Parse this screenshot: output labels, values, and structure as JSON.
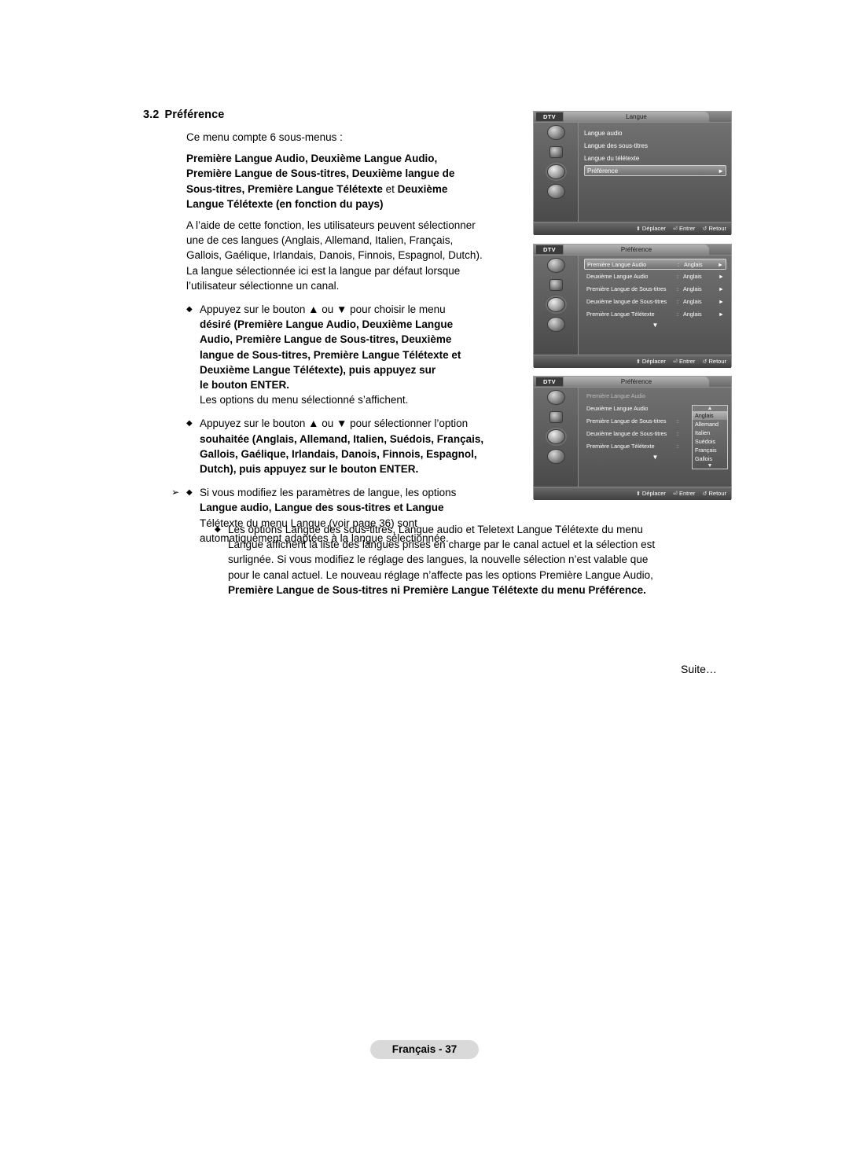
{
  "section": {
    "number": "3.2",
    "title": "Préférence",
    "intro": "Ce menu compte 6 sous-menus :",
    "submenus_line1_bold": "Première Langue Audio",
    "submenus_line1_rest": ", Deuxième Langue Audio,",
    "submenus_line2": "Première Langue de Sous-titres, Deuxième langue de",
    "submenus_line3_a": "Sous-titres, Première Langue Télétexte",
    "submenus_line3_b": " et ",
    "submenus_line3_c": "Deuxième",
    "submenus_line4": "Langue Télétexte (en fonction du pays)",
    "desc_line1": "A l’aide de cette fonction, les utilisateurs peuvent sélectionner",
    "desc_line2": "une de ces langues (Anglais, Allemand, Italien, Français,",
    "desc_line3": "Gallois, Gaélique, Irlandais, Danois, Finnois, Espagnol, Dutch).",
    "desc_line4": "La langue sélectionnée ici est la langue par défaut lorsque",
    "desc_line5": "l’utilisateur sélectionne un canal."
  },
  "bullets": [
    {
      "symbol": "◆",
      "lines": [
        "Appuyez sur le bouton ▲ ou ▼ pour choisir le menu",
        "désiré (Première Langue Audio, Deuxième Langue",
        "Audio, Première Langue de Sous-titres, Deuxième",
        "langue de Sous-titres, Première Langue Télétexte et",
        "Deuxième Langue Télétexte), puis appuyez sur",
        "le bouton ENTER.",
        "Les options du menu sélectionné s’affichent."
      ]
    },
    {
      "symbol": "◆",
      "lines": [
        "Appuyez sur le bouton ▲ ou ▼ pour sélectionner l’option",
        "souhaitée (Anglais, Allemand, Italien, Suédois, Français,",
        "Gallois, Gaélique, Irlandais, Danois, Finnois, Espagnol,",
        "Dutch), puis appuyez sur le bouton ENTER."
      ]
    }
  ],
  "arrow_block": {
    "arrow": "➢",
    "symbol": "◆",
    "lines": [
      "Si vous modifiez les paramètres de langue, les options",
      "Langue audio, Langue des sous-titres et Langue",
      "Télétexte du menu Langue (voir page 36) sont",
      "automatiquement adaptées à la langue sélectionnée."
    ]
  },
  "wide_block": {
    "symbol": "◆",
    "lines": [
      "Les options Langue des sous-titres, Langue audio et Teletext Langue Télétexte du menu",
      "Langue affichent la liste des langues prises en charge par le canal actuel et la sélection est",
      "surlignée. Si vous modifiez le réglage des langues, la nouvelle sélection n’est valable que",
      "pour le canal actuel. Le nouveau réglage n’affecte pas les options Première Langue Audio,",
      "Première Langue de Sous-titres ni Première Langue Télétexte du menu Préférence."
    ]
  },
  "suite": "Suite…",
  "footer": {
    "label": "Français - 37"
  },
  "osd_common": {
    "dtv": "DTV",
    "footer_move": "Déplacer",
    "footer_enter": "Entrer",
    "footer_return": "Retour",
    "icon_names": [
      "picture-icon",
      "sound-icon",
      "setup-icon",
      "input-icon"
    ],
    "down_arrow": "▼"
  },
  "osd1": {
    "tab": "Langue",
    "items": [
      {
        "label": "Langue audio",
        "selected": false
      },
      {
        "label": "Langue des sous-titres",
        "selected": false
      },
      {
        "label": "Langue du télétexte",
        "selected": false
      },
      {
        "label": "Préférence",
        "selected": true,
        "caret": "►"
      }
    ]
  },
  "osd2": {
    "tab": "Préférence",
    "rows": [
      {
        "label": "Première Langue Audio",
        "colon": ":",
        "value": "Anglais",
        "arrow": "►",
        "selected": true
      },
      {
        "label": "Deuxième Langue Audio",
        "colon": ":",
        "value": "Anglais",
        "arrow": "►",
        "selected": false
      },
      {
        "label": "Première Langue de Sous-titres",
        "colon": ":",
        "value": "Anglais",
        "arrow": "►",
        "selected": false
      },
      {
        "label": "Deuxième langue de Sous-titres",
        "colon": ":",
        "value": "Anglais",
        "arrow": "►",
        "selected": false
      },
      {
        "label": "Première Langue Télétexte",
        "colon": ":",
        "value": "Anglais",
        "arrow": "►",
        "selected": false
      }
    ]
  },
  "osd3": {
    "tab": "Préférence",
    "rows": [
      {
        "label": "Première Langue Audio",
        "colon": "",
        "value": "",
        "arrow": "",
        "selected": false
      },
      {
        "label": "Deuxième Langue Audio",
        "colon": "",
        "value": "",
        "arrow": "",
        "selected": false
      },
      {
        "label": "Première Langue de Sous-titres",
        "colon": ":",
        "value": "",
        "arrow": "",
        "selected": false
      },
      {
        "label": "Deuxième langue de Sous-titres",
        "colon": ":",
        "value": "",
        "arrow": "",
        "selected": false
      },
      {
        "label": "Première Langue Télétexte",
        "colon": ":",
        "value": "",
        "arrow": "",
        "selected": false
      }
    ],
    "dropdown": {
      "up": "▲",
      "down": "▼",
      "options": [
        "Anglais",
        "Allemand",
        "Italien",
        "Suédois",
        "Français",
        "Gallois"
      ],
      "highlight_index": 0
    }
  }
}
